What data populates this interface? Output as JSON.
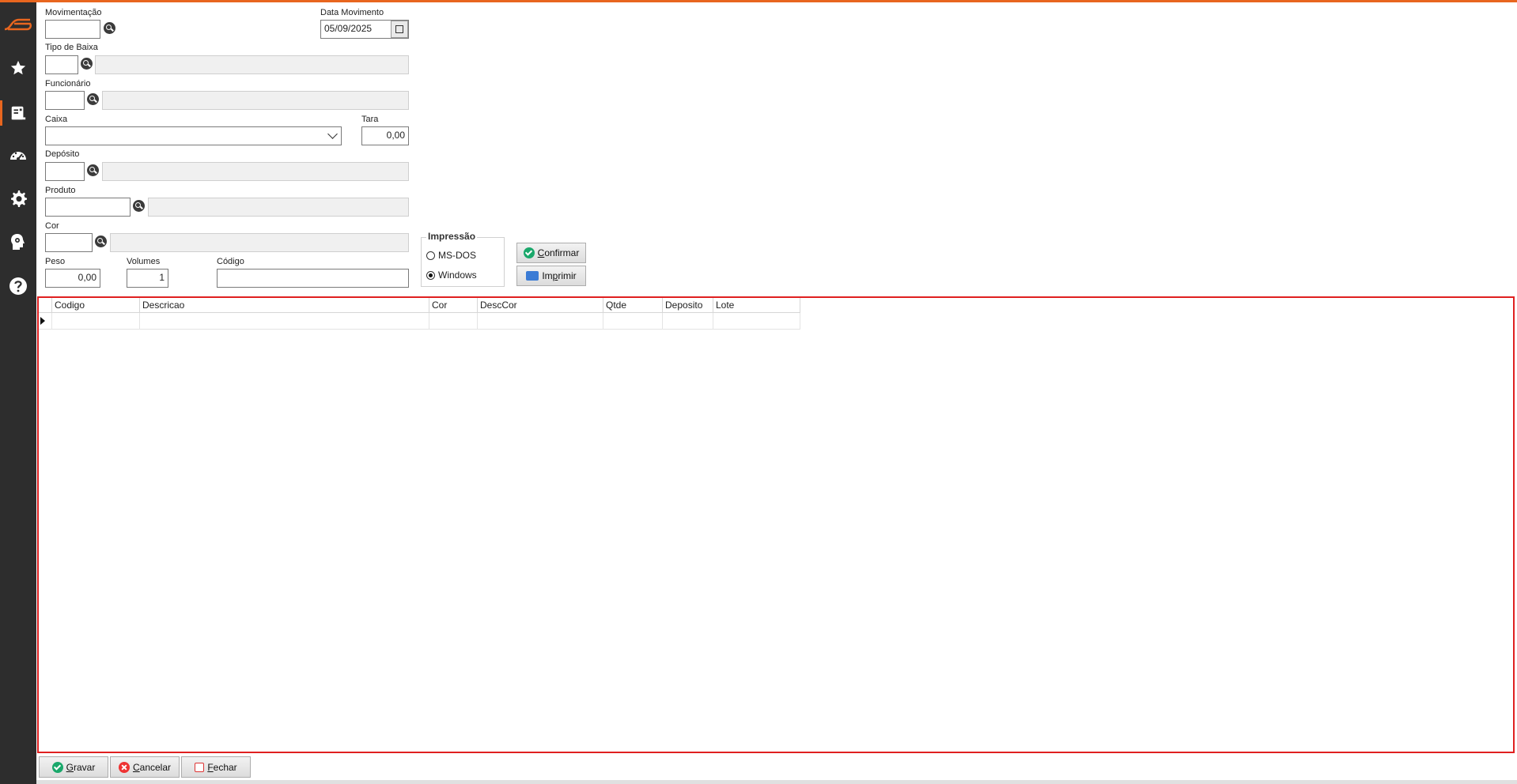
{
  "colors": {
    "accent": "#e8661f",
    "sidebar": "#2d2d2d",
    "grid_border": "#e02020"
  },
  "sidebar": {
    "items": [
      {
        "icon": "brand-logo-icon"
      },
      {
        "icon": "star-icon"
      },
      {
        "icon": "document-icon",
        "active": true
      },
      {
        "icon": "dashboard-icon"
      },
      {
        "icon": "gear-icon"
      },
      {
        "icon": "head-gear-icon"
      },
      {
        "icon": "help-icon"
      }
    ]
  },
  "form": {
    "movimentacao": {
      "label": "Movimentação",
      "value": ""
    },
    "data_movimento": {
      "label": "Data Movimento",
      "value": "05/09/2025"
    },
    "tipo_baixa": {
      "label": "Tipo de Baixa",
      "value": "",
      "desc": ""
    },
    "funcionario": {
      "label": "Funcionário",
      "value": "",
      "desc": ""
    },
    "caixa": {
      "label": "Caixa",
      "value": ""
    },
    "tara": {
      "label": "Tara",
      "value": "0,00"
    },
    "deposito": {
      "label": "Depósito",
      "value": "",
      "desc": ""
    },
    "produto": {
      "label": "Produto",
      "value": "",
      "desc": ""
    },
    "cor": {
      "label": "Cor",
      "value": "",
      "desc": ""
    },
    "peso": {
      "label": "Peso",
      "value": "0,00"
    },
    "volumes": {
      "label": "Volumes",
      "value": "1"
    },
    "codigo": {
      "label": "Código",
      "value": ""
    }
  },
  "impressao": {
    "title": "Impressão",
    "options": [
      {
        "label": "MS-DOS",
        "selected": false
      },
      {
        "label": "Windows",
        "selected": true
      }
    ]
  },
  "actions": {
    "confirmar": {
      "accel": "C",
      "rest": "onfirmar"
    },
    "imprimir": {
      "pre": "Im",
      "accel": "p",
      "rest": "rimir"
    }
  },
  "grid": {
    "columns": [
      "Codigo",
      "Descricao",
      "Cor",
      "DescCor",
      "Qtde",
      "Deposito",
      "Lote"
    ],
    "rows": [
      [
        "",
        "",
        "",
        "",
        "",
        "",
        ""
      ]
    ]
  },
  "footer": {
    "gravar": {
      "accel": "G",
      "rest": "ravar"
    },
    "cancelar": {
      "accel": "C",
      "rest": "ancelar"
    },
    "fechar": {
      "accel": "F",
      "rest": "echar"
    }
  }
}
